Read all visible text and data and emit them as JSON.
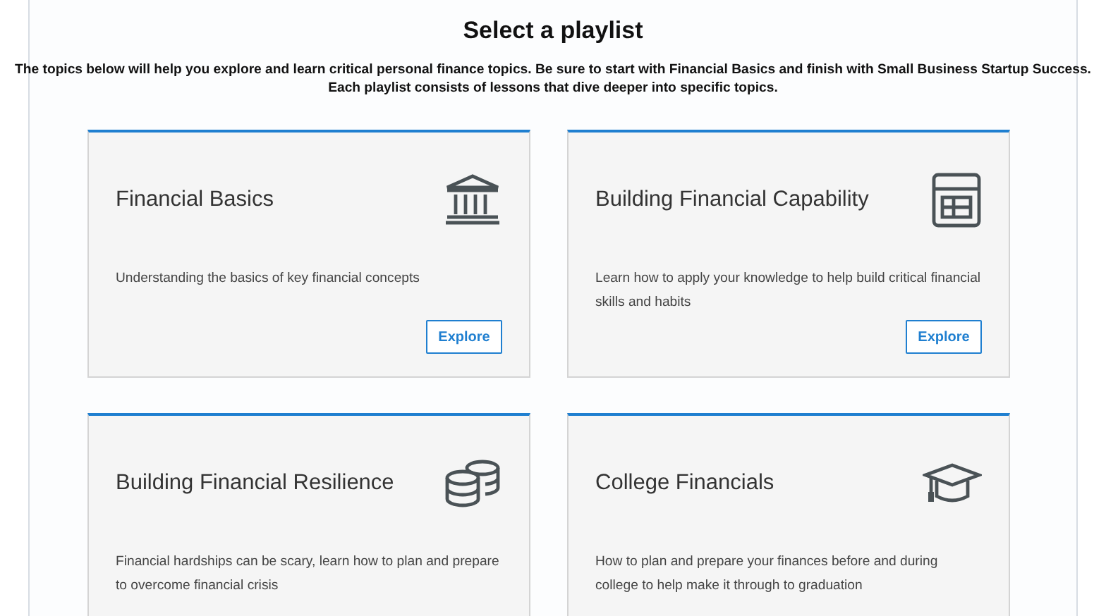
{
  "header": {
    "title": "Select a playlist",
    "intro_lines": [
      "The topics below will help you explore and learn critical personal finance topics. Be sure to start with Financial Basics and finish with Small Business Startup Success.",
      "Each playlist consists of lessons that dive deeper into specific topics."
    ]
  },
  "playlists": [
    {
      "title": "Financial Basics",
      "kind": "bank",
      "description": "Understanding the basics of key financial concepts",
      "button": {
        "label": "Explore"
      }
    },
    {
      "title": "Building Financial Capability",
      "kind": "calculator",
      "description": "Learn how to apply your knowledge to help build critical financial skills and habits",
      "button": {
        "label": "Explore"
      }
    },
    {
      "title": "Building Financial Resilience",
      "kind": "coins",
      "description": "Financial hardships can be scary, learn how to plan and prepare to overcome financial crisis"
    },
    {
      "title": "College Financials",
      "kind": "graduation-cap",
      "description": "How to plan and prepare your finances before and during college to help make it through to graduation"
    }
  ]
}
